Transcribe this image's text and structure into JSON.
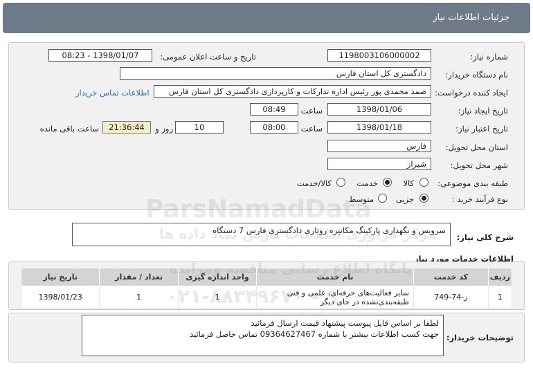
{
  "header": {
    "title": "جزئیات اطلاعات نیاز"
  },
  "form": {
    "need_number_label": "شماره نیاز:",
    "need_number": "1198003106000002",
    "announce_label": "تاریخ و ساعت اعلان عمومی:",
    "announce_value": "1398/01/07 - 08:23",
    "buyer_org_label": "نام دستگاه خریدار:",
    "buyer_org": "دادگستری کل استان فارس",
    "requester_label": "ایجاد کننده درخواست:",
    "requester": "صمد محمدی پور رئیس اداره تدارکات و کارپردازی دادگستری کل استان فارس",
    "contact_link": "اطلاعات تماس خریدار",
    "created_label": "تاریخ ایجاد نیاز:",
    "created_date": "1398/01/06",
    "created_time_label": "ساعت",
    "created_time": "08:49",
    "valid_label": "تاریخ اعتبار نیاز:",
    "valid_date": "1398/01/18",
    "valid_time_label": "ساعت",
    "valid_time": "08:00",
    "days_value": "10",
    "days_label": "روز و",
    "remaining_time": "21:36:44",
    "remaining_label": "ساعت باقی مانده",
    "province_label": "استان محل تحویل:",
    "province": "فارس",
    "city_label": "شهر محل تحویل:",
    "city": "شیراز",
    "category_label": "طبقه بندی موضوعی:",
    "category_options": [
      "کالا",
      "خدمت",
      "کالا/خدمت"
    ],
    "category_selected": "خدمت",
    "process_label": "نوع فرآیند خرید :",
    "process_options": [
      "جزیی",
      "متوسط"
    ],
    "process_selected": "جزیی"
  },
  "summary": {
    "label": "شرح کلی نیاز:",
    "text": "سرویس و نگهداری پارکینگ مکانیزه روتاری دادگستری فارس 7 دستگاه"
  },
  "services": {
    "title": "اطلاعات خدمات مورد نیاز",
    "columns": [
      "ردیف",
      "کد خدمت",
      "نام خدمت",
      "واحد اندازه گیری",
      "تعداد / مقدار",
      "تاریخ نیاز"
    ],
    "rows": [
      [
        "1",
        "ز-74-749",
        "سایر فعالیت‌های حرفه‌ای، علمی و فنی طبقه‌بندی‌نشده در جای دیگر",
        "1",
        "1",
        "1398/01/23"
      ]
    ]
  },
  "notes": {
    "label": "توضیحات خریدار:",
    "line1": "لطفا بر اساس فایل پیوست پیشنهاد قیمت ارسال فرمائید",
    "line2": "جهت کسب اطلاعات بیشتر با شماره 09364627467 تماس حاصل فرمائید"
  },
  "watermark": {
    "brand": "ParsNamadData",
    "line1": "پایگاه اطلاع رسانی مناقصه ومزایده",
    "line2": "مرکز فراوری اطلاعات پارس نماد داده ها",
    "phone": "۰۲۱-۸۸۳۴۹۶۷۰ - ۹"
  },
  "colors": {
    "header_bg": "#6f7b88",
    "panel_bg": "#f1f1f1",
    "link": "#2a6cb0",
    "remaining_bg": "#f3f0c8"
  }
}
